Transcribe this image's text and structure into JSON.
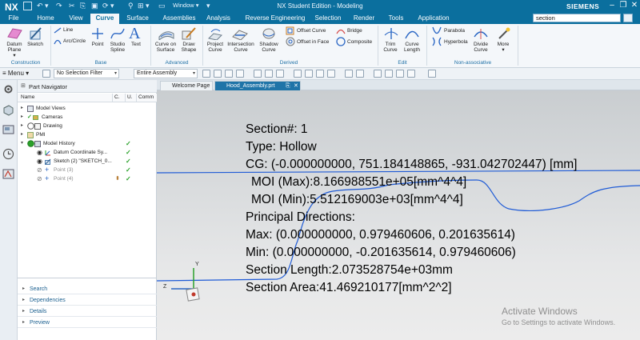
{
  "app": {
    "logo": "NX",
    "window_title": "NX Student Edition - Modeling",
    "window_menu": "Window",
    "brand": "SIEMENS",
    "search_value": "section"
  },
  "menu_tabs": [
    "File",
    "Home",
    "View",
    "Curve",
    "Surface",
    "Assemblies",
    "Analysis",
    "Reverse Engineering",
    "Selection",
    "Render",
    "Tools",
    "Application"
  ],
  "active_tab": "Curve",
  "ribbon": {
    "groups": [
      {
        "label": "Construction",
        "items": [
          "Datum Plane",
          "Sketch"
        ]
      },
      {
        "label": "Base",
        "items": [
          "Line",
          "Arc/Circle",
          "Point",
          "Studio Spline",
          "Text"
        ]
      },
      {
        "label": "Advanced",
        "items": [
          "Curve on Surface",
          "Draw Shape"
        ]
      },
      {
        "label": "Derived",
        "items": [
          "Project Curve",
          "Intersection Curve",
          "Shadow Curve",
          "Offset Curve",
          "Offset in Face",
          "Bridge",
          "Composite"
        ]
      },
      {
        "label": "Edit",
        "items": [
          "Trim Curve",
          "Curve Length"
        ]
      },
      {
        "label": "Non-associative",
        "items": [
          "Parabola",
          "Hyperbola",
          "Divide Curve",
          "More"
        ]
      }
    ]
  },
  "toolbar": {
    "menu": "Menu",
    "filter": "No Selection Filter",
    "scope": "Entire Assembly"
  },
  "navigator": {
    "title": "Part Navigator",
    "columns": [
      "Name",
      "C.",
      "U.",
      "Comm"
    ],
    "rows": [
      {
        "label": "Model Views",
        "indent": 0,
        "checked": false,
        "greyed": false
      },
      {
        "label": "Cameras",
        "indent": 0,
        "checked": false,
        "greyed": false
      },
      {
        "label": "Drawing",
        "indent": 0,
        "checked": false,
        "greyed": false
      },
      {
        "label": "PMI",
        "indent": 0,
        "checked": false,
        "greyed": false
      },
      {
        "label": "Model History",
        "indent": 0,
        "checked": true,
        "greyed": false
      },
      {
        "label": "Datum Coordinate Sy...",
        "indent": 1,
        "checked": true,
        "greyed": false
      },
      {
        "label": "Sketch (2) \"SKETCH_0...",
        "indent": 1,
        "checked": true,
        "greyed": false
      },
      {
        "label": "Point (3)",
        "indent": 1,
        "checked": true,
        "greyed": true
      },
      {
        "label": "Point (4)",
        "indent": 1,
        "checked": true,
        "greyed": true
      }
    ],
    "panels": [
      "Search",
      "Dependencies",
      "Details",
      "Preview"
    ]
  },
  "doc_tabs": [
    "Welcome Page",
    "Hood_Assembly.prt"
  ],
  "active_doc": "Hood_Assembly.prt",
  "section_info": [
    "Section#: 1",
    "Type: Hollow",
    "CG: (-0.000000000, 751.184148865, -931.042702447) [mm]",
    "MOI (Max):8.166988551e+05[mm^4^4]",
    "MOI (Min):5.512169003e+03[mm^4^4]",
    "Principal Directions:",
    "Max: (0.000000000, 0.979460606, 0.201635614)",
    "Min: (0.000000000, -0.201635614, 0.979460606)",
    "Section Length:2.073528754e+03mm",
    "Section Area:41.469210177[mm^2^2]"
  ],
  "triad": {
    "z": "Z",
    "y": "Y"
  },
  "watermark": {
    "line1": "Activate Windows",
    "line2": "Go to Settings to activate Windows."
  },
  "colors": {
    "title_bar": "#0b6f9e",
    "curve": "#1f5bd6",
    "check": "#2aa12a"
  }
}
